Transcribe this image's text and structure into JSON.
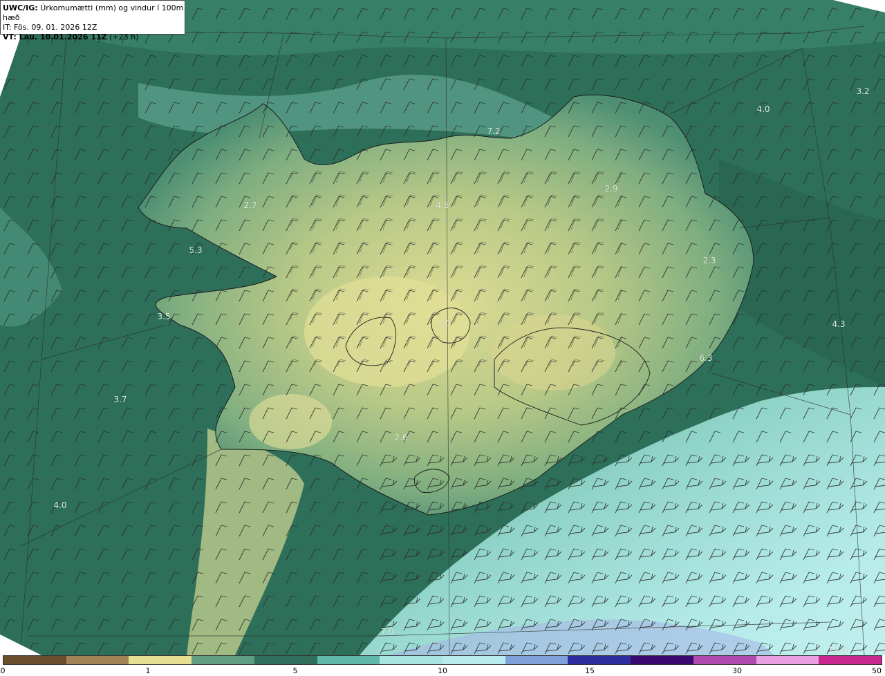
{
  "header": {
    "model": "UWC/IG:",
    "field": "Úrkomumætti (mm) og vindur í 100m hæð",
    "init_time": "IT: Fös. 09. 01. 2026 12Z",
    "valid_prefix": "VT: ",
    "valid_time": "Lau. 10.01.2026 11Z",
    "lead_time": "(+23 h)"
  },
  "map_labels": [
    {
      "text": "3.2"
    },
    {
      "text": "4.0"
    },
    {
      "text": "7.2"
    },
    {
      "text": "2.9"
    },
    {
      "text": "2.7"
    },
    {
      "text": "4.5"
    },
    {
      "text": "5.3"
    },
    {
      "text": "2.3"
    },
    {
      "text": "3.5"
    },
    {
      "text": "1.0"
    },
    {
      "text": "4.3"
    },
    {
      "text": "6.3"
    },
    {
      "text": "3.7"
    },
    {
      "text": "2.6"
    },
    {
      "text": "4.0"
    },
    {
      "text": "7.0"
    },
    {
      "text": "12.4"
    }
  ],
  "colorbar": {
    "ticks": [
      "0",
      "1",
      "5",
      "10",
      "15",
      "30",
      "50"
    ],
    "colors": [
      "#6b4e2e",
      "#a08456",
      "#e6df92",
      "#5f9e82",
      "#2f6e5b",
      "#5fb8a8",
      "#a8e4e0",
      "#b8ecee",
      "#7fa0d8",
      "#2d2da0",
      "#3a0a72",
      "#b04ab0",
      "#e8a0e0",
      "#c8288f"
    ]
  },
  "colors": {
    "ocean_deep": "#2b6b57",
    "ocean_mid": "#3e8a70",
    "land_light": "#d8d890",
    "land_mid": "#8fb888",
    "shelf_light": "#a8dcd8"
  }
}
